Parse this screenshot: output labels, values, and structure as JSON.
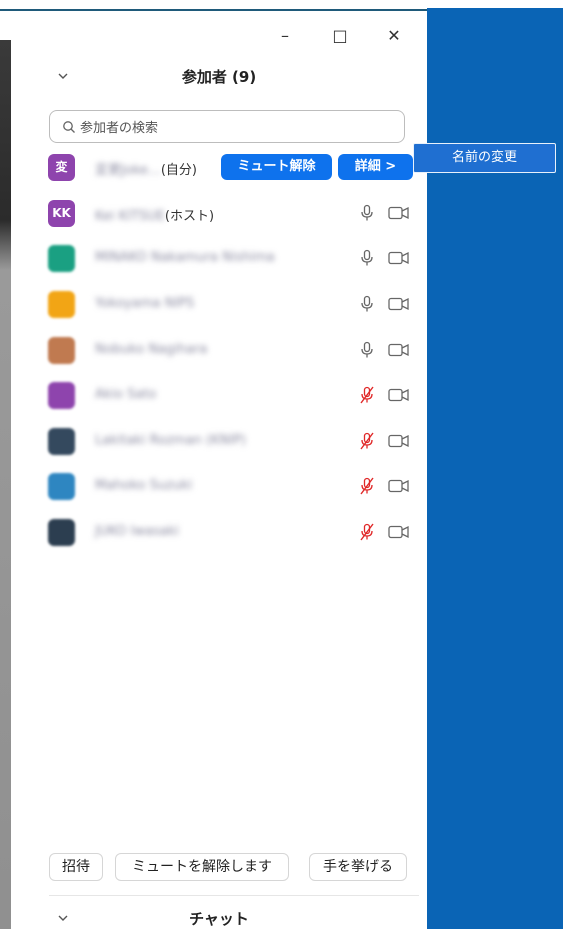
{
  "window": {
    "minimize": "–",
    "maximize": "□",
    "close": "✕"
  },
  "panel": {
    "title": "参加者 (9)",
    "search_placeholder": "参加者の検索"
  },
  "participants": [
    {
      "initials": "変",
      "name": "変更Joke…",
      "suffix": "(自分)",
      "color": "#8e44ad",
      "self": true
    },
    {
      "initials": "KK",
      "name": "Kei KITSUE",
      "suffix": "(ホスト)",
      "color": "#8e44ad",
      "muted": false
    },
    {
      "initials": "",
      "name": "MINAKO Nakamura Nishima",
      "suffix": "",
      "color": "#1aa082",
      "muted": false
    },
    {
      "initials": "",
      "name": "Yokoyama NIPS",
      "suffix": "",
      "color": "#f2a515",
      "muted": false
    },
    {
      "initials": "",
      "name": "Nobuko Nagihara",
      "suffix": "",
      "color": "#c07a50",
      "muted": false
    },
    {
      "initials": "",
      "name": "Akio Sato",
      "suffix": "",
      "color": "#8e44ad",
      "muted": true
    },
    {
      "initials": "",
      "name": "Lakitaki Rozman (KNIP)",
      "suffix": "",
      "color": "#34495e",
      "muted": true
    },
    {
      "initials": "",
      "name": "Mahoko Suzuki",
      "suffix": "",
      "color": "#2e86c1",
      "muted": true
    },
    {
      "initials": "",
      "name": "JUKO Iwasaki",
      "suffix": "",
      "color": "#2c3e50",
      "muted": true
    }
  ],
  "self_actions": {
    "unmute": "ミュート解除",
    "more": "詳細 >",
    "rename": "名前の変更"
  },
  "footer": {
    "invite": "招待",
    "unmute_me": "ミュートを解除します",
    "raise_hand": "手を挙げる"
  },
  "chat": {
    "title": "チャット"
  },
  "colors": {
    "accent": "#0e72ed",
    "muted_red": "#e02828"
  }
}
